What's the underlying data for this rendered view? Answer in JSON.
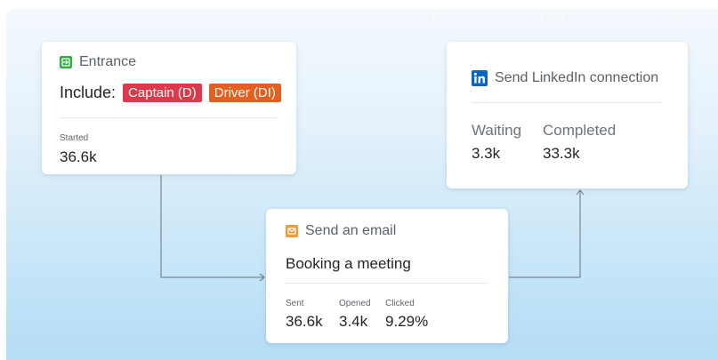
{
  "entrance": {
    "title": "Entrance",
    "include_label": "Include:",
    "badges": [
      {
        "label": "Captain (D)",
        "color": "#dc3a4b"
      },
      {
        "label": "Driver (DI)",
        "color": "#e5601e"
      }
    ],
    "stat_label": "Started",
    "stat_value": "36.6k",
    "icon_color": "#2fae3e"
  },
  "email": {
    "title": "Send an email",
    "subject": "Booking a meeting",
    "stats": [
      {
        "label": "Sent",
        "value": "36.6k"
      },
      {
        "label": "Opened",
        "value": "3.4k"
      },
      {
        "label": "Clicked",
        "value": "9.29%"
      }
    ],
    "icon_color": "#f29b38"
  },
  "linkedin": {
    "title": "Send LinkedIn connection",
    "stats": [
      {
        "label": "Waiting",
        "value": "3.3k"
      },
      {
        "label": "Completed",
        "value": "33.3k"
      }
    ],
    "icon_color": "#0a66c2"
  },
  "connector_color": "#6b7177"
}
